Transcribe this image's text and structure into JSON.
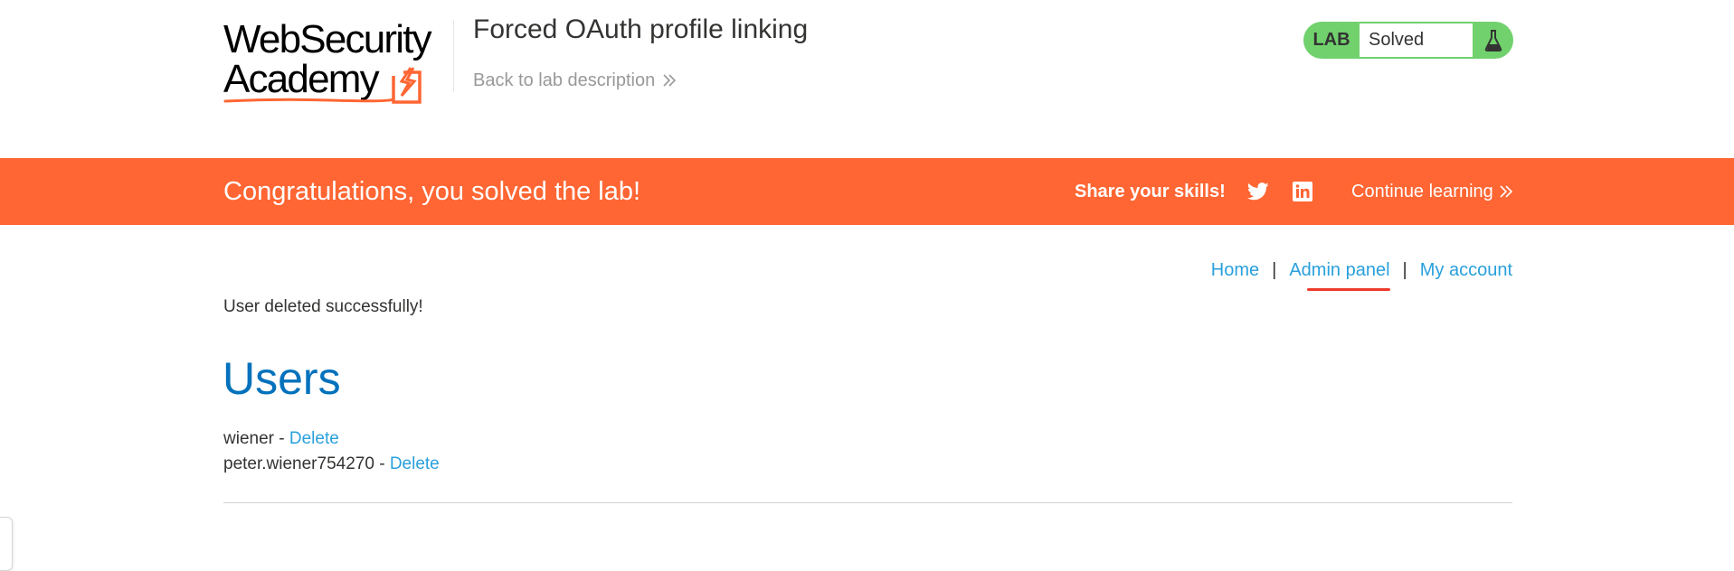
{
  "logo": {
    "line1": "WebSecurity",
    "line2": "Academy"
  },
  "header": {
    "lab_title": "Forced OAuth profile linking",
    "back_link": "Back to lab description"
  },
  "lab_status": {
    "label": "LAB",
    "value": "Solved",
    "icon": "flask-icon"
  },
  "banner": {
    "message": "Congratulations, you solved the lab!",
    "share_label": "Share your skills!",
    "continue_label": "Continue learning",
    "icons": [
      "twitter-icon",
      "linkedin-icon"
    ]
  },
  "nav": {
    "home": "Home",
    "admin": "Admin panel",
    "account": "My account",
    "separator": "|"
  },
  "main": {
    "message": "User deleted successfully!",
    "heading": "Users",
    "users": [
      {
        "name": "wiener",
        "separator": " - ",
        "action": "Delete"
      },
      {
        "name": "peter.wiener754270",
        "separator": " - ",
        "action": "Delete"
      }
    ]
  },
  "colors": {
    "brand_orange": "#ff6633",
    "status_green": "#70d16d",
    "link_blue": "#29a0dc",
    "heading_blue": "#0071bc",
    "active_underline": "#ee3a2b"
  }
}
